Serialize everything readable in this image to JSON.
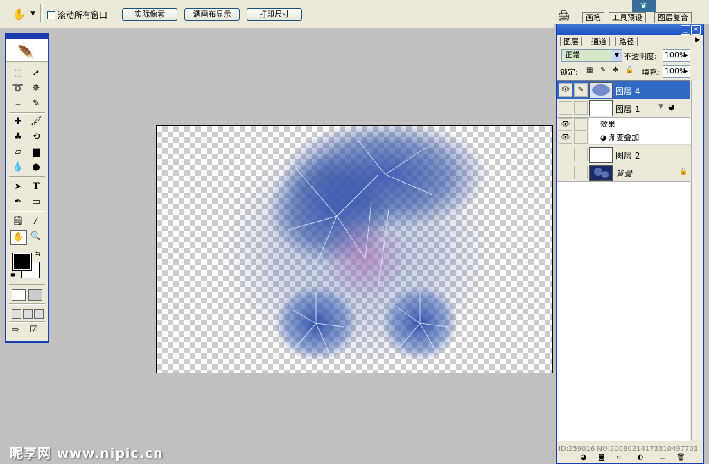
{
  "options_bar": {
    "tool_icon": "hand-icon",
    "scroll_all_windows_label": "滚动所有窗口",
    "scroll_all_windows_checked": false,
    "buttons": [
      "实际像素",
      "满画布显示",
      "打印尺寸"
    ]
  },
  "palette_well": {
    "tabs": [
      "画笔",
      "工具预设",
      "图层复合"
    ]
  },
  "toolbox": {
    "tools": [
      "marquee-icon",
      "move-icon",
      "lasso-icon",
      "magic-wand-icon",
      "crop-icon",
      "slice-icon",
      "healing-icon",
      "brush-icon",
      "stamp-icon",
      "history-brush-icon",
      "eraser-icon",
      "gradient-icon",
      "blur-icon",
      "dodge-icon",
      "path-select-icon",
      "type-icon",
      "pen-icon",
      "shape-icon",
      "notes-icon",
      "eyedropper-icon",
      "hand-icon",
      "zoom-icon"
    ],
    "type_label": "T",
    "foreground_color": "#000000",
    "background_color": "#ffffff"
  },
  "layers_panel": {
    "tabs": [
      "图层",
      "通道",
      "路径"
    ],
    "blend_mode": "正常",
    "opacity_label": "不透明度:",
    "opacity_value": "100%",
    "lock_label": "锁定:",
    "fill_label": "填充:",
    "fill_value": "100%",
    "layers": [
      {
        "name": "图层 4",
        "visible": true,
        "selected": true
      },
      {
        "name": "图层 1",
        "visible": false,
        "selected": false
      },
      {
        "name": "图层 2",
        "visible": false,
        "selected": false
      },
      {
        "name": "背景",
        "visible": false,
        "selected": false
      }
    ],
    "effects_label": "效果",
    "effect_item": "渐变叠加"
  },
  "watermark": {
    "site": "昵享网 www.nipic.cn",
    "id_text": "ID:259016 NO:20080214173310497701"
  },
  "colors": {
    "app_bg": "#c0c0c0",
    "panel_bg": "#ece9d8",
    "accent": "#1a3eb0",
    "selection": "#316ac5"
  }
}
